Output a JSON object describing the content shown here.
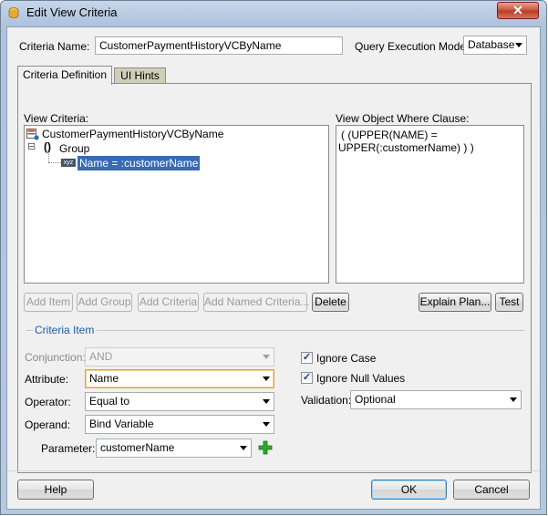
{
  "window": {
    "title": "Edit View Criteria",
    "close_glyph": "✕"
  },
  "header": {
    "criteria_name_label": "Criteria Name:",
    "criteria_name_value": "CustomerPaymentHistoryVCByName",
    "query_mode_label": "Query Execution Mode:",
    "query_mode_value": "Database"
  },
  "tabs": [
    {
      "label": "Criteria Definition",
      "active": true
    },
    {
      "label": "UI Hints",
      "active": false
    }
  ],
  "view_criteria": {
    "label": "View Criteria:",
    "root": "CustomerPaymentHistoryVCByName",
    "group_toggle": "⊟",
    "group_glyph": "()",
    "group": "Group",
    "item_badge": "xyz",
    "item": "Name = :customerName"
  },
  "where_clause": {
    "label": "View Object Where Clause:",
    "line1": "( (UPPER(NAME) =",
    "line2": "UPPER(:customerName) ) )"
  },
  "toolbar": {
    "add_item": "Add Item",
    "add_group": "Add Group",
    "add_criteria": "Add Criteria",
    "add_named_criteria": "Add Named Criteria...",
    "delete": "Delete",
    "explain_plan": "Explain Plan...",
    "test": "Test"
  },
  "criteria_item": {
    "section_label": "Criteria Item",
    "conjunction_label": "Conjunction:",
    "conjunction_value": "AND",
    "attribute_label": "Attribute:",
    "attribute_value": "Name",
    "operator_label": "Operator:",
    "operator_value": "Equal to",
    "operand_label": "Operand:",
    "operand_value": "Bind Variable",
    "parameter_label": "Parameter:",
    "parameter_value": "customerName",
    "ignore_case_label": "Ignore Case",
    "ignore_case_checked": true,
    "ignore_null_label": "Ignore Null Values",
    "ignore_null_checked": true,
    "validation_label": "Validation:",
    "validation_value": "Optional",
    "check_glyph": "✓"
  },
  "footer": {
    "help": "Help",
    "ok": "OK",
    "cancel": "Cancel"
  },
  "colors": {
    "selection": "#3a69b6",
    "add_icon": "#2fa82a",
    "tab_inactive": "#cfcfb8"
  }
}
